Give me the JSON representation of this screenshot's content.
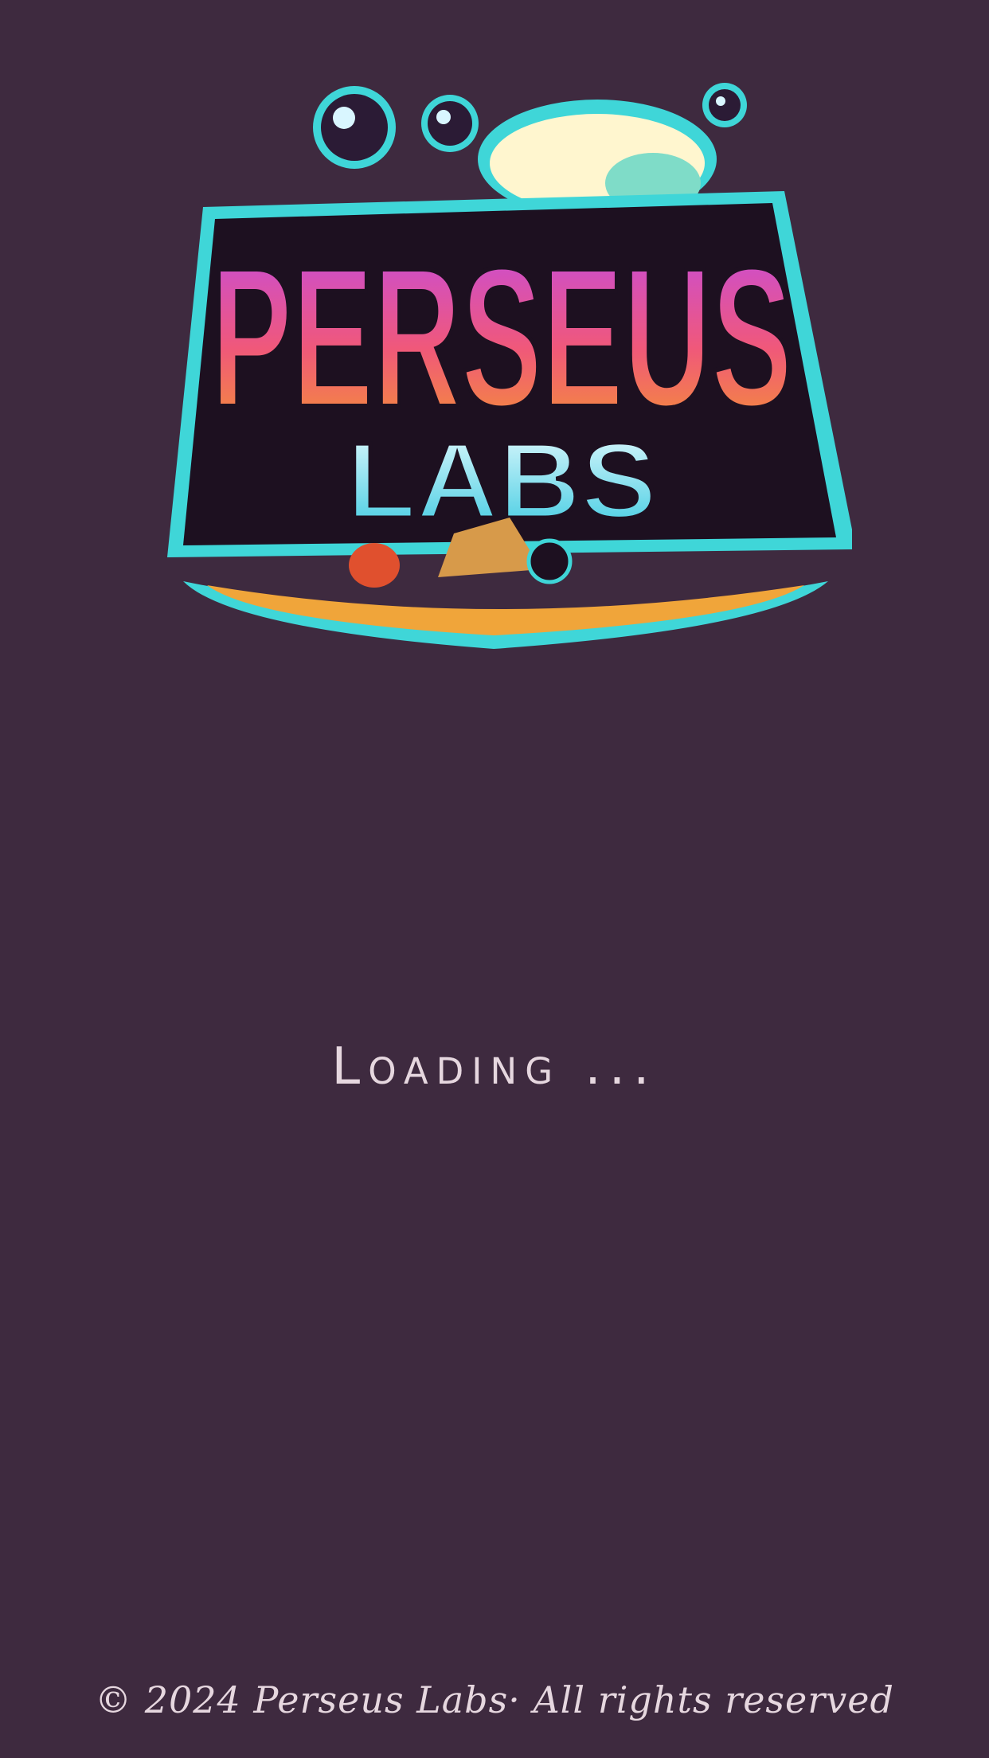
{
  "app": {
    "logo_name": "Perseus Labs logo",
    "logo_text": {
      "line1": "PERSEUS",
      "line2": "LABS"
    }
  },
  "loading": {
    "text": "Loading ..."
  },
  "footer": {
    "copyright": "© 2024 Perseus Labs· All rights reserved"
  },
  "colors": {
    "background": "#3e2a3f",
    "text": "#e6d7df",
    "logo_outline": "#3fd6d8",
    "logo_purple": "#c24be6",
    "logo_orange": "#f59a2a",
    "logo_cyan": "#49d6e8"
  }
}
